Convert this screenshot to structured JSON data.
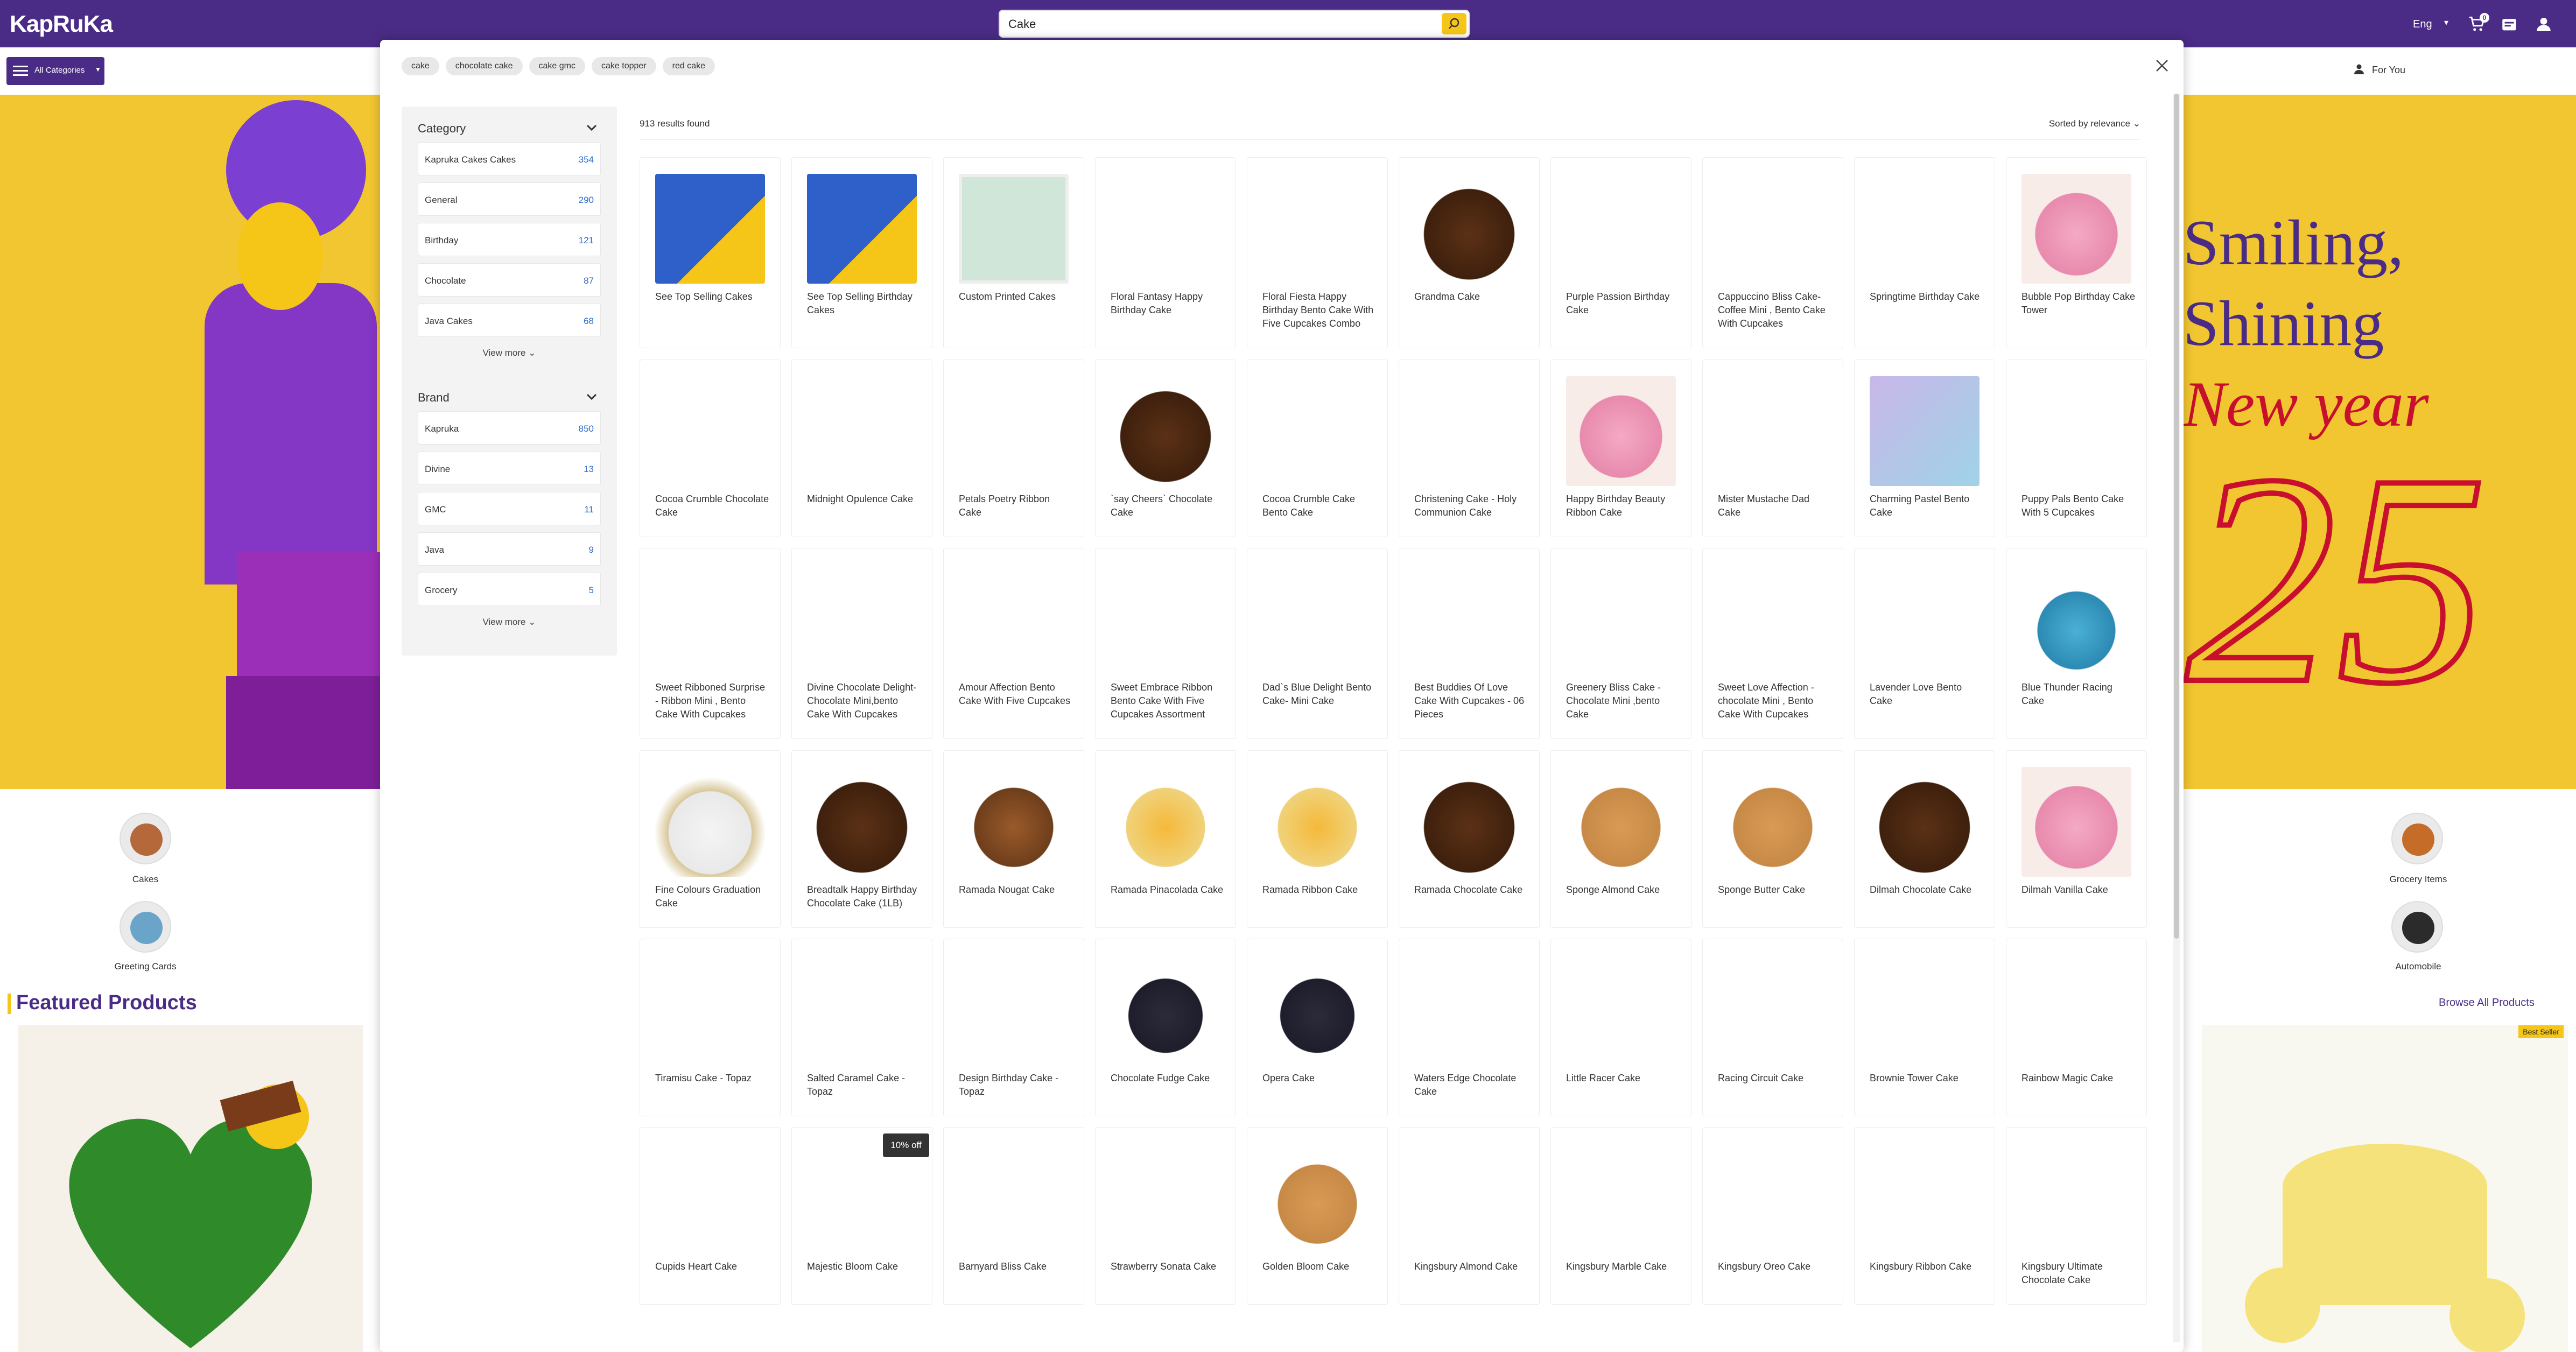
{
  "header": {
    "logo": "KapRuKa",
    "search_value": "Cake",
    "language": "Eng",
    "cart_count": "0"
  },
  "catbar": {
    "all_categories": "All Categories",
    "for_you": "For You"
  },
  "hero": {
    "line1": "Smiling,",
    "line2": "Shining",
    "line3": "New year",
    "year": "25"
  },
  "home_categories": [
    {
      "label": "Cakes"
    },
    {
      "label": "Greeting Cards"
    },
    {
      "label": "Grocery Items"
    },
    {
      "label": "Automobile"
    }
  ],
  "featured": {
    "title": "Featured Products",
    "browse_all": "Browse All Products",
    "badge": "Best Seller"
  },
  "search": {
    "chips": [
      "cake",
      "chocolate cake",
      "cake gmc",
      "cake topper",
      "red cake"
    ],
    "results_count": "913 results found",
    "sort_label": "Sorted by relevance"
  },
  "filters": {
    "category": {
      "title": "Category",
      "items": [
        {
          "name": "Kapruka Cakes Cakes",
          "count": "354"
        },
        {
          "name": "General",
          "count": "290"
        },
        {
          "name": "Birthday",
          "count": "121"
        },
        {
          "name": "Chocolate",
          "count": "87"
        },
        {
          "name": "Java Cakes",
          "count": "68"
        }
      ],
      "view_more": "View more"
    },
    "brand": {
      "title": "Brand",
      "items": [
        {
          "name": "Kapruka",
          "count": "850"
        },
        {
          "name": "Divine",
          "count": "13"
        },
        {
          "name": "GMC",
          "count": "11"
        },
        {
          "name": "Java",
          "count": "9"
        },
        {
          "name": "Grocery",
          "count": "5"
        }
      ],
      "view_more": "View more"
    }
  },
  "products": [
    {
      "title": "See Top Selling Cakes",
      "img": "banner"
    },
    {
      "title": "See Top Selling Birthday Cakes",
      "img": "banner"
    },
    {
      "title": "Custom Printed Cakes",
      "img": "printed"
    },
    {
      "title": "Floral Fantasy Happy Birthday Cake",
      "img": ""
    },
    {
      "title": "Floral Fiesta Happy Birthday Bento Cake With Five Cupcakes Combo",
      "img": ""
    },
    {
      "title": "Grandma Cake",
      "img": "choc"
    },
    {
      "title": "Purple Passion Birthday Cake",
      "img": ""
    },
    {
      "title": "Cappuccino Bliss Cake- Coffee Mini , Bento Cake With Cupcakes",
      "img": ""
    },
    {
      "title": "Springtime Birthday Cake",
      "img": ""
    },
    {
      "title": "Bubble Pop Birthday Cake Tower",
      "img": "pink"
    },
    {
      "title": "Cocoa Crumble Chocolate Cake",
      "img": ""
    },
    {
      "title": "Midnight Opulence Cake",
      "img": ""
    },
    {
      "title": "Petals Poetry Ribbon Cake",
      "img": ""
    },
    {
      "title": "`say Cheers` Chocolate Cake",
      "img": "choc"
    },
    {
      "title": "Cocoa Crumble Cake Bento Cake",
      "img": ""
    },
    {
      "title": "Christening Cake - Holy Communion Cake",
      "img": ""
    },
    {
      "title": "Happy Birthday Beauty Ribbon Cake",
      "img": "pink"
    },
    {
      "title": "Mister Mustache Dad Cake",
      "img": ""
    },
    {
      "title": "Charming Pastel Bento Cake",
      "img": "pastel"
    },
    {
      "title": "Puppy Pals Bento Cake With 5 Cupcakes",
      "img": ""
    },
    {
      "title": "Sweet Ribboned Surprise - Ribbon Mini , Bento Cake With Cupcakes",
      "img": ""
    },
    {
      "title": "Divine Chocolate Delight- Chocolate Mini,bento Cake With Cupcakes",
      "img": ""
    },
    {
      "title": "Amour Affection Bento Cake With Five Cupcakes",
      "img": ""
    },
    {
      "title": "Sweet Embrace Ribbon Bento Cake With Five Cupcakes Assortment",
      "img": ""
    },
    {
      "title": "Dad`s Blue Delight Bento Cake- Mini Cake",
      "img": ""
    },
    {
      "title": "Best Buddies Of Love Cake With Cupcakes - 06 Pieces",
      "img": ""
    },
    {
      "title": "Greenery Bliss Cake - Chocolate Mini ,bento Cake",
      "img": ""
    },
    {
      "title": "Sweet Love Affection - chocolate Mini , Bento Cake With Cupcakes",
      "img": ""
    },
    {
      "title": "Lavender Love Bento Cake",
      "img": ""
    },
    {
      "title": "Blue Thunder Racing Cake",
      "img": "blue"
    },
    {
      "title": "Fine Colours Graduation Cake",
      "img": "white"
    },
    {
      "title": "Breadtalk Happy Birthday Chocolate Cake (1LB)",
      "img": "choc"
    },
    {
      "title": "Ramada Nougat Cake",
      "img": "nougat"
    },
    {
      "title": "Ramada Pinacolada Cake",
      "img": "yellow"
    },
    {
      "title": "Ramada Ribbon Cake",
      "img": "yellow"
    },
    {
      "title": "Ramada Chocolate Cake",
      "img": "choc"
    },
    {
      "title": "Sponge Almond Cake",
      "img": "sponge"
    },
    {
      "title": "Sponge Butter Cake",
      "img": "sponge"
    },
    {
      "title": "Dilmah Chocolate Cake",
      "img": "choc"
    },
    {
      "title": "Dilmah Vanilla Cake",
      "img": "pink"
    },
    {
      "title": "Tiramisu Cake - Topaz",
      "img": ""
    },
    {
      "title": "Salted Caramel Cake - Topaz",
      "img": ""
    },
    {
      "title": "Design Birthday Cake - Topaz",
      "img": ""
    },
    {
      "title": "Chocolate Fudge Cake",
      "img": "dark"
    },
    {
      "title": "Opera Cake",
      "img": "dark"
    },
    {
      "title": "Waters Edge Chocolate Cake",
      "img": ""
    },
    {
      "title": "Little Racer Cake",
      "img": ""
    },
    {
      "title": "Racing Circuit Cake",
      "img": ""
    },
    {
      "title": "Brownie Tower Cake",
      "img": ""
    },
    {
      "title": "Rainbow Magic Cake",
      "img": ""
    },
    {
      "title": "Cupids Heart Cake",
      "img": ""
    },
    {
      "title": "Majestic Bloom Cake",
      "img": ""
    },
    {
      "title": "Barnyard Bliss Cake",
      "img": ""
    },
    {
      "title": "Strawberry Sonata Cake",
      "img": ""
    },
    {
      "title": "Golden Bloom Cake",
      "img": "sponge"
    },
    {
      "title": "Kingsbury Almond Cake",
      "img": ""
    },
    {
      "title": "Kingsbury Marble Cake",
      "img": ""
    },
    {
      "title": "Kingsbury Oreo Cake",
      "img": ""
    },
    {
      "title": "Kingsbury Ribbon Cake",
      "img": ""
    },
    {
      "title": "Kingsbury Ultimate Chocolate Cake",
      "img": ""
    }
  ],
  "discount_badge": "10% off",
  "colors": {
    "brand_purple": "#4a2c86",
    "accent_yellow": "#f5c518",
    "link_blue": "#2a6bcf"
  }
}
